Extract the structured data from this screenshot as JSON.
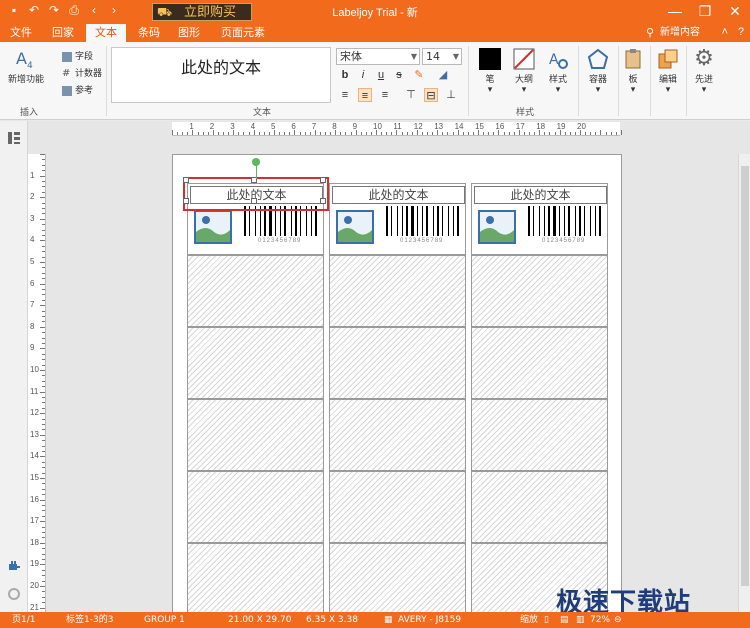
{
  "titlebar": {
    "title": "Labeljoy Trial - 新",
    "buy_label": "立即购买",
    "quick_access": [
      "save-icon",
      "undo-icon",
      "redo-icon",
      "print-icon",
      "back-icon",
      "forward-icon"
    ],
    "window_controls": [
      "minimize",
      "restore",
      "close"
    ]
  },
  "tabs": [
    {
      "label": "文件",
      "active": false
    },
    {
      "label": "回家",
      "active": false
    },
    {
      "label": "文本",
      "active": true
    },
    {
      "label": "条码",
      "active": false
    },
    {
      "label": "图形",
      "active": false
    },
    {
      "label": "页面元素",
      "active": false
    }
  ],
  "new_content": "新增内容",
  "ribbon": {
    "insert_group": {
      "label": "插入",
      "big_button": "新增功能",
      "small_buttons": [
        "字段",
        "计数器",
        "参考"
      ]
    },
    "text_group": {
      "label": "文本",
      "preview_text": "此处的文本",
      "font_name": "宋体",
      "font_size": "14"
    },
    "style_group": {
      "label": "样式",
      "buttons": [
        "笔",
        "大纲",
        "样式"
      ]
    },
    "other_buttons": [
      "容器",
      "板",
      "编辑",
      "先进"
    ]
  },
  "labels": {
    "text": "此处的文本",
    "barcode_number": "0123456789"
  },
  "statusbar": {
    "page": "页1/1",
    "labels": "标签1-3的3",
    "group": "GROUP 1",
    "page_size": "21.00 X 29.70",
    "label_size": "6.35 X 3.38",
    "template": "AVERY - J8159",
    "zoom_label": "缩放",
    "zoom": "72%"
  },
  "watermark": "极速下载站",
  "colors": {
    "accent": "#f26b1d",
    "selection": "#d62d2d",
    "swatch_black": "#000000"
  }
}
